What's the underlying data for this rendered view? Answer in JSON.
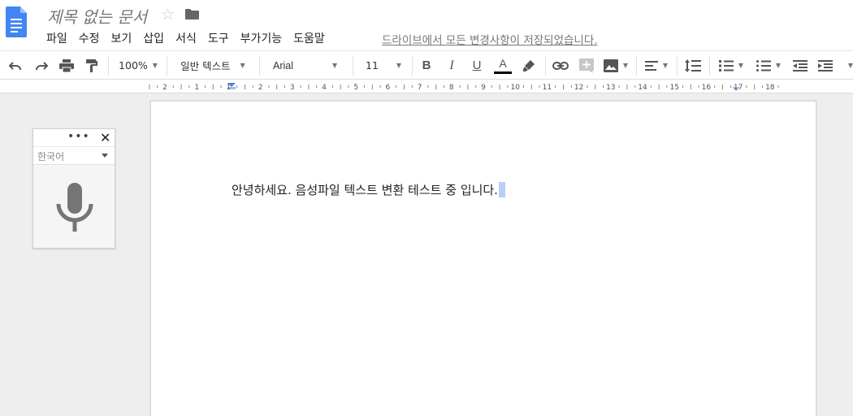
{
  "header": {
    "title": "제목 없는 문서",
    "star_icon": "star-outline-icon",
    "folder_icon": "folder-icon",
    "save_status": "드라이브에서 모든 변경사항이 저장되었습니다."
  },
  "menubar": {
    "items": [
      "파일",
      "수정",
      "보기",
      "삽입",
      "서식",
      "도구",
      "부가기능",
      "도움말"
    ]
  },
  "toolbar": {
    "zoom": "100%",
    "style": "일반 텍스트",
    "font": "Arial",
    "size": "11",
    "bold": "B",
    "italic": "I",
    "underline": "U",
    "text_color": "A",
    "accent_color": "#000000"
  },
  "ruler": {
    "ticks": [
      "2",
      "1",
      "1",
      "2",
      "3",
      "4",
      "5",
      "6",
      "7",
      "8",
      "9",
      "10",
      "11",
      "12",
      "13",
      "14",
      "15",
      "16",
      "17",
      "18"
    ]
  },
  "document": {
    "body_text": "안녕하세요. 음성파일 텍스트 변환 테스트 중 입니다."
  },
  "voice_typing": {
    "dots": "•••",
    "close": "✕",
    "language": "한국어"
  },
  "colors": {
    "docs_blue": "#4285f4",
    "selection": "#b8cff5",
    "mic_gray": "#757575"
  }
}
